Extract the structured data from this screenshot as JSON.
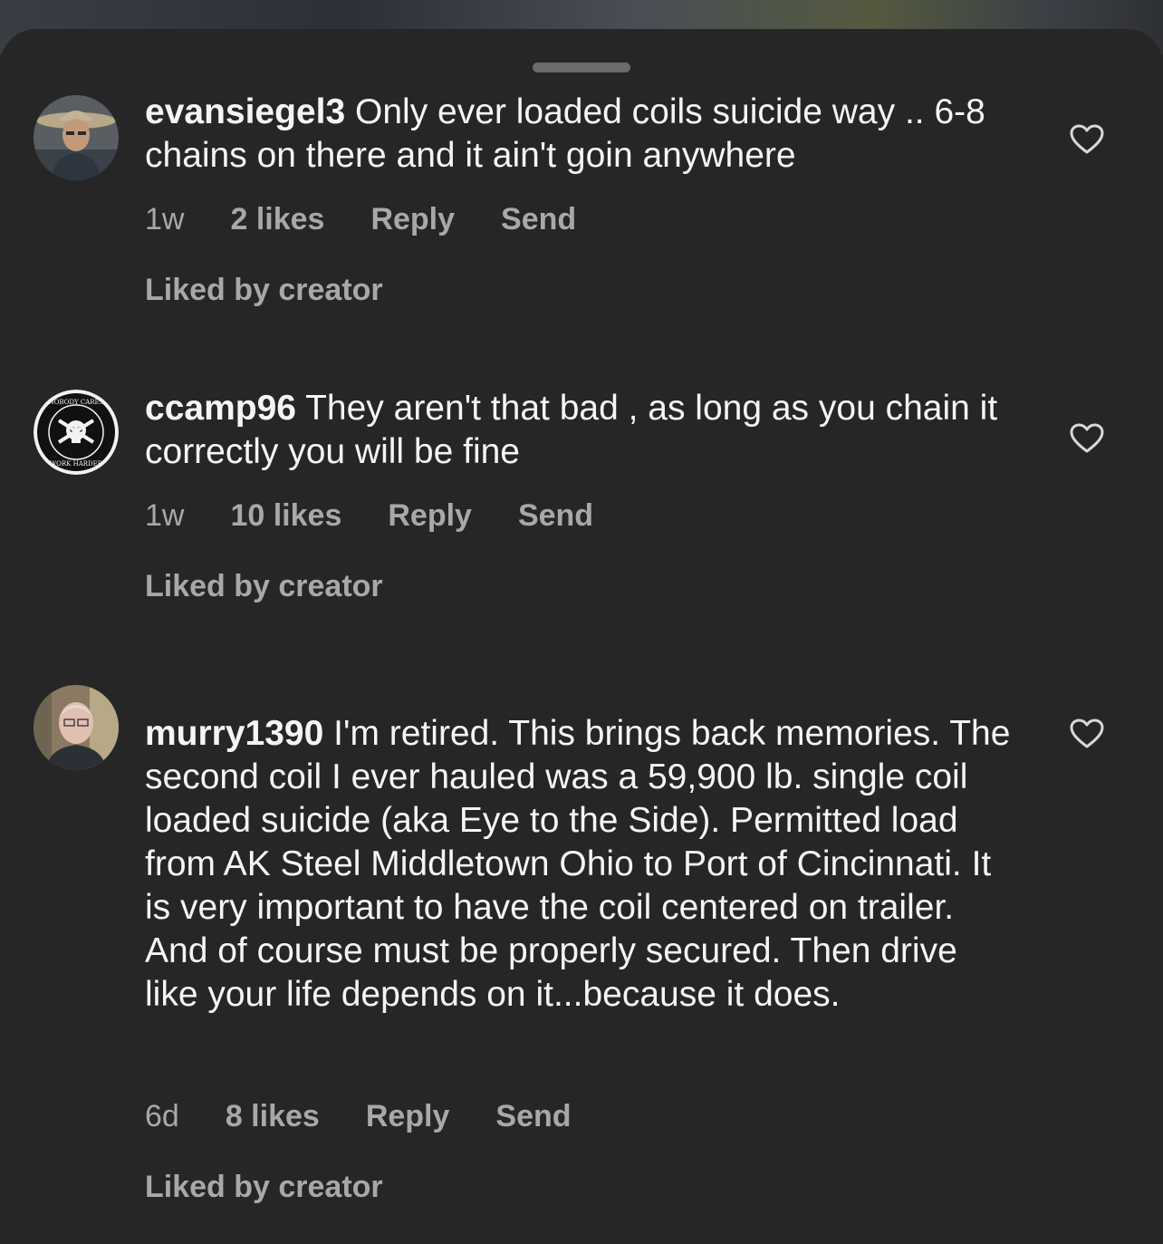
{
  "comments": [
    {
      "username": "evansiegel3",
      "text": "Only ever loaded coils suicide way .. 6-8 chains on there and it ain't goin anywhere",
      "age": "1w",
      "likes": "2 likes",
      "reply": "Reply",
      "send": "Send",
      "liked_by": "Liked by creator"
    },
    {
      "username": "ccamp96",
      "text": "They aren't that bad , as long as you chain it correctly you will be fine",
      "age": "1w",
      "likes": "10 likes",
      "reply": "Reply",
      "send": "Send",
      "liked_by": "Liked by creator",
      "avatar_text": "NOBODY CARES WORK HARDER"
    },
    {
      "username": "murry1390",
      "text": "I'm retired. This brings back memories.  The second coil I ever hauled was a 59,900 lb. single coil loaded suicide (aka Eye to the Side). Permitted load from AK Steel Middletown Ohio to Port of Cincinnati. It is very important to have the coil centered on trailer. And of course must be properly secured. Then drive like your life depends on it...because it does.",
      "age": "6d",
      "likes": "8 likes",
      "reply": "Reply",
      "send": "Send",
      "liked_by": "Liked by creator"
    }
  ],
  "icons": {
    "like": "heart-outline-icon",
    "grabber": "sheet-grabber"
  },
  "colors": {
    "background": "#262626",
    "primary_text": "#f5f5f5",
    "secondary_text": "#a8a8a8"
  }
}
